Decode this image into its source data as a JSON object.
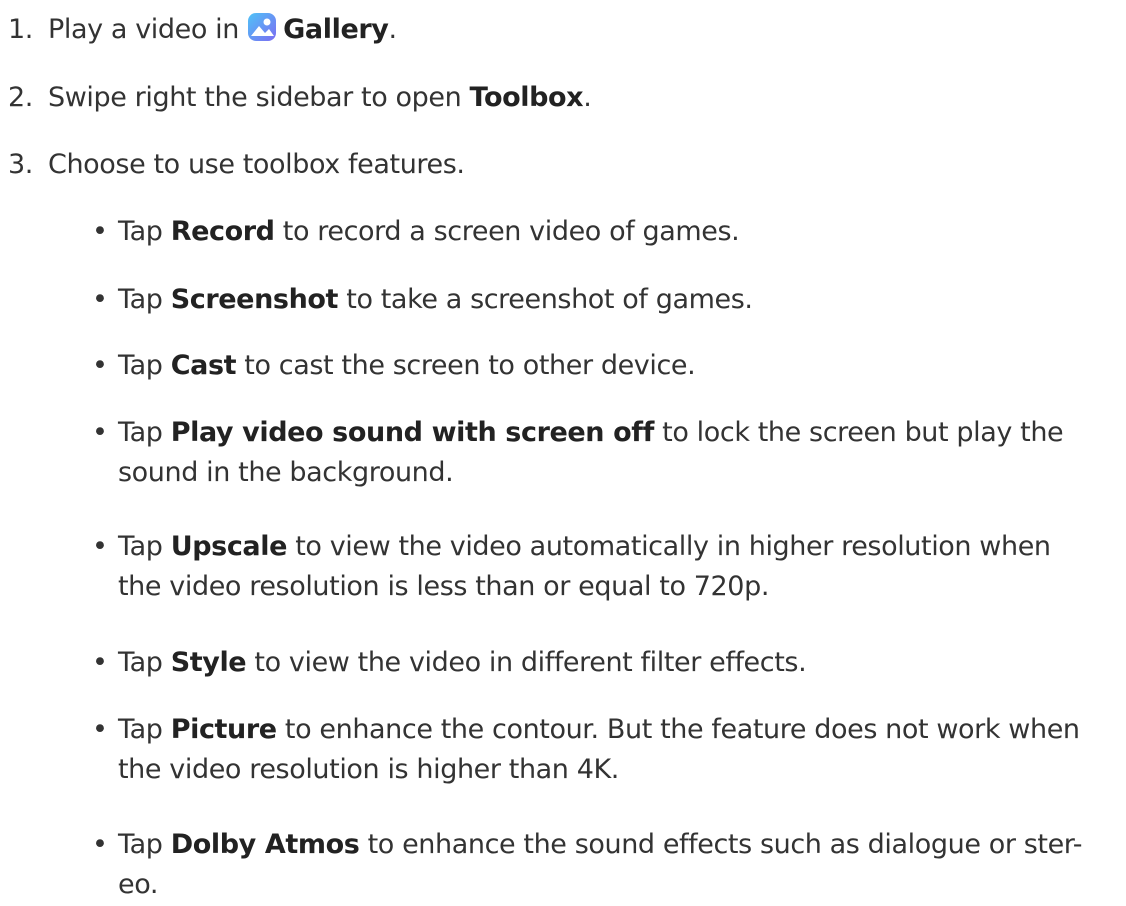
{
  "steps": [
    {
      "num": "1.",
      "pre": "Play a video in ",
      "bold": "Gallery",
      "post": ".",
      "icon": "gallery-app-icon"
    },
    {
      "num": "2.",
      "pre": "Swipe right the sidebar to open ",
      "bold": "Toolbox",
      "post": "."
    },
    {
      "num": "3.",
      "pre": "Choose to use toolbox features.",
      "bold": "",
      "post": ""
    }
  ],
  "bullets": [
    {
      "bold": "Record",
      "line1": " to record a screen video of games.",
      "line2": ""
    },
    {
      "bold": "Screenshot",
      "line1": " to take a screenshot of games.",
      "line2": ""
    },
    {
      "bold": "Cast",
      "line1": " to cast the screen to other device.",
      "line2": ""
    },
    {
      "bold": "Play video sound with screen off",
      "line1": " to lock the screen but play the",
      "line2": "sound in the background."
    },
    {
      "bold": "Upscale",
      "line1": " to view the video automatically in higher resolution when",
      "line2": "the video resolution is less than or equal to 720p."
    },
    {
      "bold": "Style",
      "line1": " to view the video in different filter effects.",
      "line2": ""
    },
    {
      "bold": "Picture",
      "line1": " to enhance the contour. But the feature does not work when",
      "line2": "the video resolution is higher than 4K."
    },
    {
      "bold": "Dolby Atmos",
      "line1": " to enhance the sound effects such as dialogue or ster-",
      "line2": "eo."
    }
  ],
  "bullet_prefix": "Tap ",
  "bullet_glyph": "•",
  "colors": {
    "text": "#333333",
    "icon_gradient_top": "#4fc3f7",
    "icon_gradient_bottom": "#7c6cf2"
  }
}
